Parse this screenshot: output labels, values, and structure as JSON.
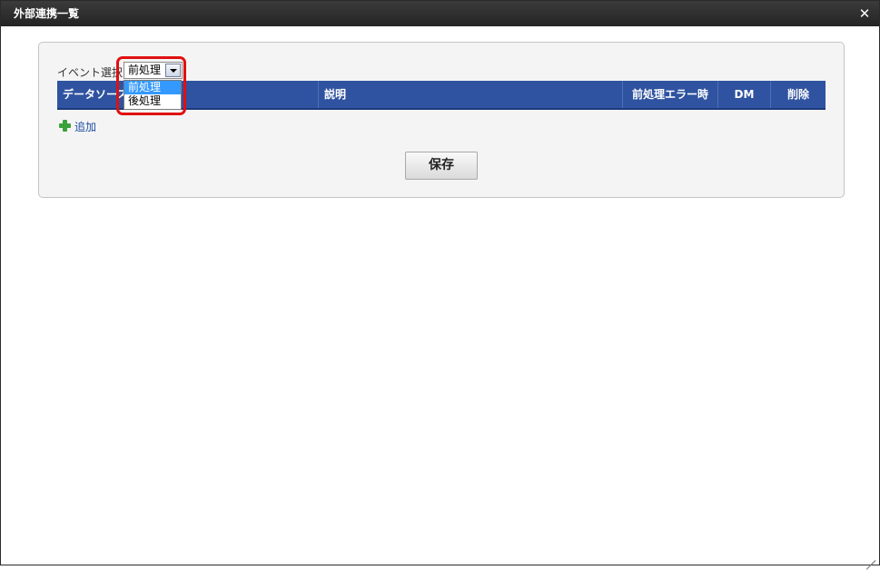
{
  "window": {
    "title": "外部連携一覧",
    "close_icon": "close-icon"
  },
  "event_select": {
    "label": "イベント選択",
    "selected": "前処理",
    "options": [
      "前処理",
      "後処理"
    ]
  },
  "table": {
    "columns": [
      "データソース",
      "説明",
      "前処理エラー時",
      "DM",
      "削除"
    ],
    "header_color": "#2f53a0"
  },
  "add_link": {
    "label": "追加",
    "icon": "plus-icon"
  },
  "save_button": {
    "label": "保存"
  },
  "annotation": {
    "highlight_color": "#e01010"
  }
}
